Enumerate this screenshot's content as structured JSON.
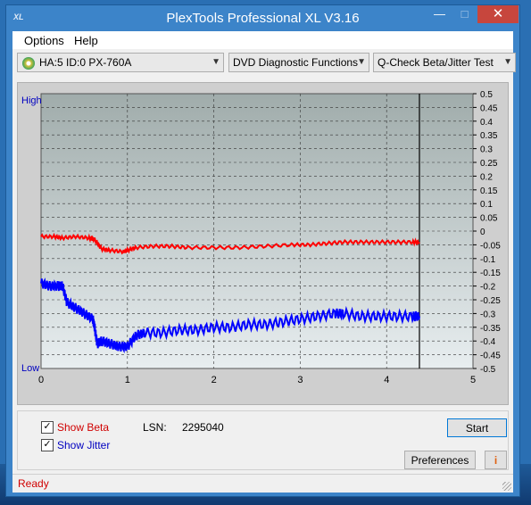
{
  "window": {
    "title": "PlexTools Professional XL V3.16",
    "icon_label": "XL"
  },
  "menu": {
    "options": "Options",
    "help": "Help"
  },
  "toolbar": {
    "drive": "HA:5 ID:0  PX-760A",
    "function": "DVD Diagnostic Functions",
    "test": "Q-Check Beta/Jitter Test"
  },
  "chart_data": {
    "type": "line",
    "x_range": [
      0,
      5
    ],
    "x_ticks": [
      "0",
      "1",
      "2",
      "3",
      "4",
      "5"
    ],
    "y_range": [
      -0.5,
      0.5
    ],
    "y_ticks": [
      "0.5",
      "0.45",
      "0.4",
      "0.35",
      "0.3",
      "0.25",
      "0.2",
      "0.15",
      "0.1",
      "0.05",
      "0",
      "-0.05",
      "-0.1",
      "-0.15",
      "-0.2",
      "-0.25",
      "-0.3",
      "-0.35",
      "-0.4",
      "-0.45",
      "-0.5"
    ],
    "left_labels": {
      "high": "High",
      "low": "Low"
    },
    "end_marker_x": 4.38,
    "grid": true,
    "series": [
      {
        "color": "#ff0000",
        "x": [
          0.0,
          0.15,
          0.25,
          0.4,
          0.55,
          0.62,
          0.7,
          0.8,
          0.95,
          1.0,
          1.1,
          1.3,
          1.5,
          1.7,
          2.0,
          2.3,
          2.6,
          2.9,
          3.1,
          3.3,
          3.5,
          3.7,
          3.9,
          4.1,
          4.3,
          4.38
        ],
        "y": [
          -0.02,
          -0.02,
          -0.025,
          -0.02,
          -0.025,
          -0.03,
          -0.065,
          -0.07,
          -0.075,
          -0.07,
          -0.06,
          -0.055,
          -0.055,
          -0.06,
          -0.06,
          -0.06,
          -0.055,
          -0.05,
          -0.05,
          -0.045,
          -0.04,
          -0.04,
          -0.04,
          -0.04,
          -0.04,
          -0.04
        ]
      },
      {
        "color": "#0000ff",
        "x": [
          0.0,
          0.1,
          0.2,
          0.25,
          0.3,
          0.4,
          0.5,
          0.6,
          0.62,
          0.65,
          0.7,
          0.8,
          0.9,
          1.0,
          1.1,
          1.2,
          1.4,
          1.6,
          1.8,
          2.0,
          2.2,
          2.4,
          2.6,
          2.8,
          3.0,
          3.2,
          3.4,
          3.5,
          3.7,
          3.9,
          4.1,
          4.3,
          4.38
        ],
        "y": [
          -0.19,
          -0.2,
          -0.2,
          -0.2,
          -0.26,
          -0.28,
          -0.3,
          -0.32,
          -0.35,
          -0.41,
          -0.4,
          -0.41,
          -0.42,
          -0.42,
          -0.38,
          -0.37,
          -0.37,
          -0.36,
          -0.36,
          -0.35,
          -0.35,
          -0.34,
          -0.34,
          -0.33,
          -0.32,
          -0.31,
          -0.3,
          -0.3,
          -0.31,
          -0.31,
          -0.31,
          -0.31,
          -0.31
        ]
      }
    ]
  },
  "options": {
    "show_beta": "Show Beta",
    "show_jitter": "Show Jitter",
    "lsn_label": "LSN:",
    "lsn_value": "2295040"
  },
  "buttons": {
    "start": "Start",
    "preferences": "Preferences",
    "info": "i"
  },
  "status": {
    "text": "Ready"
  }
}
